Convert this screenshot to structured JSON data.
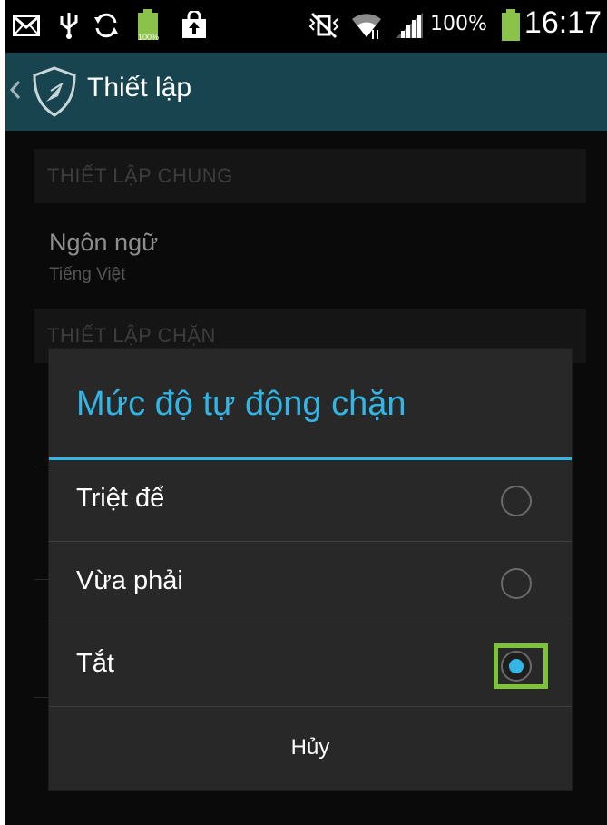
{
  "status_bar": {
    "battery_percent_small": "100%",
    "battery_percent": "100%",
    "time": "16:17",
    "icons": [
      "mail-icon",
      "usb-icon",
      "sync-icon",
      "battery-small-icon",
      "shopping-bag-icon",
      "mute-vibrate-icon",
      "wifi-icon",
      "signal-icon",
      "battery-icon"
    ]
  },
  "action_bar": {
    "title": "Thiết lập",
    "colors": {
      "background": "#17444f"
    }
  },
  "background": {
    "section_general": "THIẾT LẬP CHUNG",
    "language_title": "Ngôn ngữ",
    "language_value": "Tiếng Việt",
    "section_blocking": "THIẾT LẬP CHẶN"
  },
  "dialog": {
    "title": "Mức độ tự động chặn",
    "options": [
      {
        "label": "Triệt để",
        "selected": false
      },
      {
        "label": "Vừa phải",
        "selected": false
      },
      {
        "label": "Tắt",
        "selected": true
      }
    ],
    "cancel_label": "Hủy",
    "colors": {
      "accent": "#33b5e5",
      "highlight": "#7cc33a",
      "background": "#282828"
    }
  }
}
